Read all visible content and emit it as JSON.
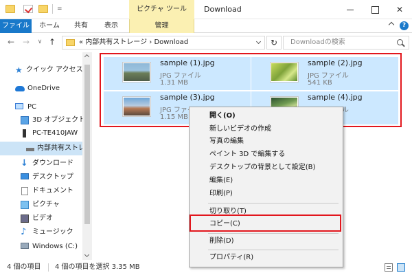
{
  "title_bar": {
    "context_tab": "ピクチャ ツール",
    "window_title": "Download",
    "quick_access_pin": "=",
    "minimize_icon": "minimize-icon",
    "maximize_icon": "maximize-icon",
    "close_glyph": "✕"
  },
  "ribbon": {
    "tabs": [
      "ファイル",
      "ホーム",
      "共有",
      "表示",
      "管理"
    ],
    "help_glyph": "?"
  },
  "address_bar": {
    "back_glyph": "←",
    "forward_glyph": "→",
    "recent_glyph": "∨",
    "up_glyph": "↑",
    "path": "« 内部共有ストレージ  ›  Download",
    "refresh_glyph": "↻",
    "search_placeholder": "Downloadの検索"
  },
  "nav_pane": {
    "items": [
      {
        "label": "クイック アクセス",
        "icon": "star-icon"
      },
      {
        "label": "OneDrive",
        "icon": "cloud-icon"
      },
      {
        "label": "PC",
        "icon": "pc-icon"
      },
      {
        "label": "3D オブジェクト",
        "icon": "cube-icon"
      },
      {
        "label": "PC-TE410JAW",
        "icon": "device-icon"
      },
      {
        "label": "内部共有ストレージ",
        "icon": "drive-icon",
        "selected": true
      },
      {
        "label": "ダウンロード",
        "icon": "download-icon"
      },
      {
        "label": "デスクトップ",
        "icon": "desktop-icon"
      },
      {
        "label": "ドキュメント",
        "icon": "document-icon"
      },
      {
        "label": "ピクチャ",
        "icon": "picture-icon"
      },
      {
        "label": "ビデオ",
        "icon": "video-icon"
      },
      {
        "label": "ミュージック",
        "icon": "music-icon"
      },
      {
        "label": "Windows (C:)",
        "icon": "windows-drive-icon"
      }
    ]
  },
  "files": [
    {
      "name": "sample (1).jpg",
      "type": "JPG ファイル",
      "size": "1.31 MB"
    },
    {
      "name": "sample (2).jpg",
      "type": "JPG ファイル",
      "size": "541 KB"
    },
    {
      "name": "sample (3).jpg",
      "type": "JPG ファイル",
      "size": "1.15 MB"
    },
    {
      "name": "sample (4).jpg",
      "type": "JPG ファイル",
      "size": ""
    }
  ],
  "status_bar": {
    "item_count": "4 個の項目",
    "selection": "4 個の項目を選択  3.35 MB"
  },
  "context_menu": {
    "items": [
      {
        "label": "開く(O)",
        "bold": true
      },
      {
        "label": "新しいビデオの作成"
      },
      {
        "label": "写真の編集"
      },
      {
        "label": "ペイント 3D で編集する"
      },
      {
        "label": "デスクトップの背景として設定(B)"
      },
      {
        "label": "編集(E)"
      },
      {
        "label": "印刷(P)"
      },
      {
        "label": "切り取り(T)"
      },
      {
        "label": "コピー(C)"
      },
      {
        "label": "削除(D)"
      },
      {
        "label": "プロパティ(R)"
      }
    ]
  },
  "colors": {
    "selection": "#cce8ff",
    "ribbon_file_tab": "#1979ca",
    "context_tab": "#fbf0b2",
    "highlight_box": "#e2161d",
    "menu_background": "#f2f2f2"
  }
}
